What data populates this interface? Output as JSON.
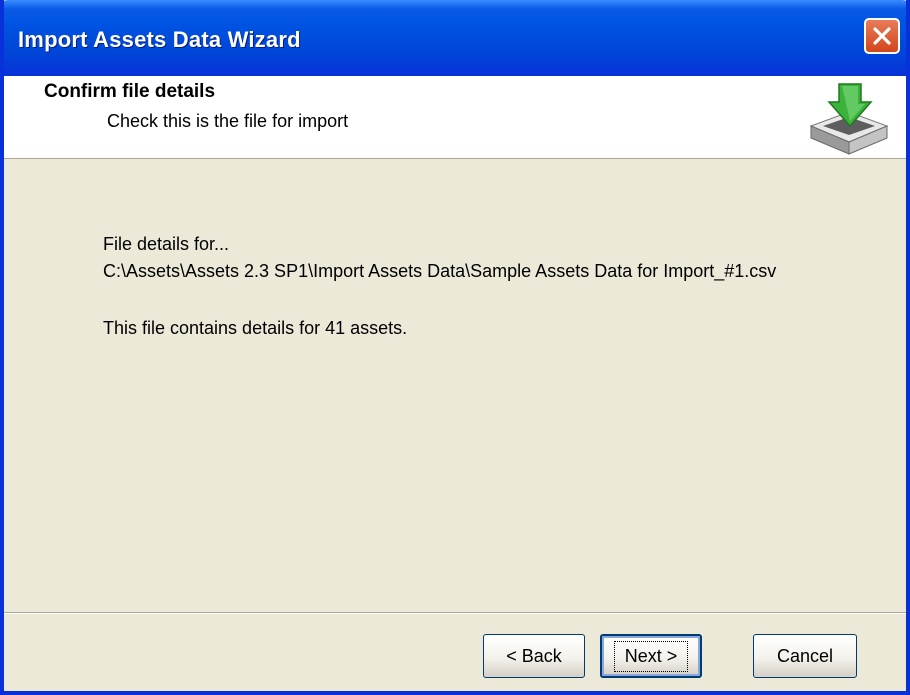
{
  "window": {
    "title": "Import Assets Data Wizard"
  },
  "header": {
    "title": "Confirm file details",
    "subtitle": "Check this is the file for import"
  },
  "content": {
    "details_label": "File details for...",
    "file_path": "C:\\Assets\\Assets 2.3 SP1\\Import Assets Data\\Sample Assets Data for Import_#1.csv",
    "summary": "This file contains details for 41 assets."
  },
  "buttons": {
    "back": "< Back",
    "next": "Next >",
    "cancel": "Cancel"
  },
  "icons": {
    "close": "close-icon",
    "header": "import-tray-icon"
  },
  "colors": {
    "titlebar": "#0054E3",
    "dialog_bg": "#ECE9D8",
    "close_button": "#D2461C",
    "arrow_green": "#3BB33B"
  }
}
